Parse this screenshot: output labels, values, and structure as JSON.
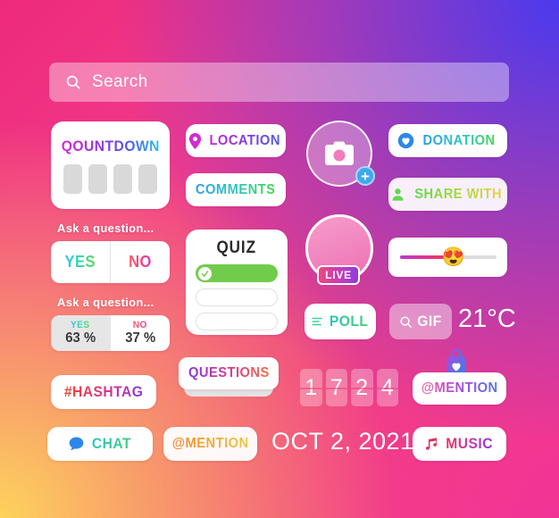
{
  "search": {
    "placeholder": "Search",
    "icon": "search-icon"
  },
  "countdown": {
    "label": "QOUNTDOWN",
    "boxes": [
      "",
      "",
      "",
      ""
    ]
  },
  "ask_question": {
    "prompt_1": "Ask a question...",
    "prompt_2": "Ask a question...",
    "yes_label": "YES",
    "no_label": "NO",
    "result_yes_label": "YES",
    "result_no_label": "NO",
    "result_yes_value": "63 %",
    "result_no_value": "37 %"
  },
  "stickers": {
    "location": {
      "label": "LOCATION",
      "icon": "location-pin-icon"
    },
    "comments": {
      "label": "COMMENTS"
    },
    "questions": {
      "label": "QUESTIONS"
    },
    "poll": {
      "label": "POLL",
      "icon": "poll-bars-icon"
    },
    "gif": {
      "label": "GIF",
      "icon": "search-icon"
    },
    "donation": {
      "label": "DONATION",
      "icon": "heart-circle-icon"
    },
    "share_with": {
      "label": "SHARE WITH",
      "icon": "person-icon"
    },
    "hashtag": {
      "label": "#HASHTAG"
    },
    "chat": {
      "label": "CHAT",
      "icon": "chat-bubble-icon"
    },
    "mention_orange": {
      "label": "@MENTION"
    },
    "mention_shop": {
      "label": "@MENTION",
      "icon": "shopping-bag-heart-icon"
    },
    "music": {
      "label": "MUSIC",
      "icon": "music-note-icon"
    },
    "date": {
      "label": "OCT 2, 2021"
    },
    "temperature": {
      "label": "21°C"
    }
  },
  "quiz": {
    "title": "QUIZ",
    "options": [
      {
        "text": "",
        "selected": true
      },
      {
        "text": "",
        "selected": false
      },
      {
        "text": "",
        "selected": false
      }
    ]
  },
  "camera": {
    "icon": "camera-icon",
    "badge": "+",
    "badge_icon": "plus-icon"
  },
  "live": {
    "badge_label": "LIVE"
  },
  "emoji_slider": {
    "emoji": "😍",
    "fill_percent": 56
  },
  "flip_countdown": {
    "digits": [
      "1",
      "7",
      "2",
      "4"
    ]
  },
  "colors": {
    "bg_magenta": "#ee2a7b",
    "bg_blue": "#4a3aee",
    "bg_orange": "#fdd35c",
    "bg_pink": "#f1309a",
    "card_white": "#ffffff",
    "quiz_green": "#72cc4c",
    "live_badge": "#f2457f",
    "plus_blue": "#3fa8f0"
  }
}
